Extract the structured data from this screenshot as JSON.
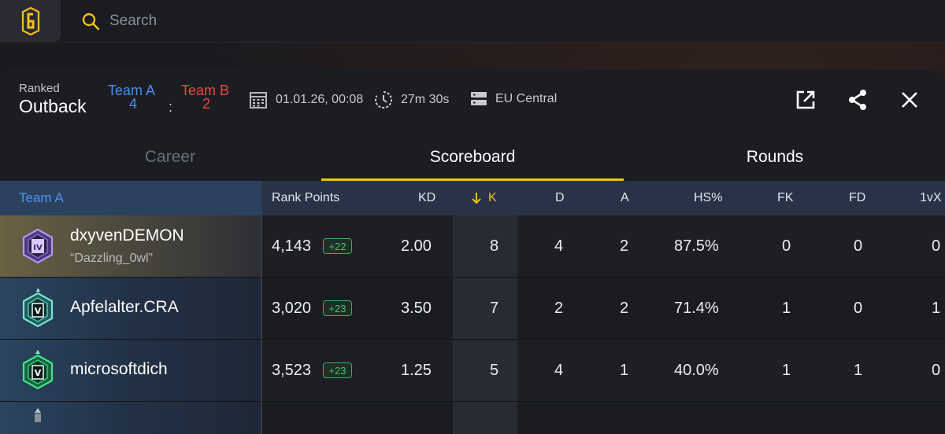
{
  "search": {
    "placeholder": "Search"
  },
  "match": {
    "mode": "Ranked",
    "map": "Outback",
    "team_a": {
      "name": "Team A",
      "score": "4"
    },
    "team_b": {
      "name": "Team B",
      "score": "2"
    },
    "score_separator": ":",
    "datetime": "01.01.26, 00:08",
    "duration": "27m 30s",
    "server": "EU Central"
  },
  "tabs": [
    {
      "label": "Career",
      "active": false
    },
    {
      "label": "Scoreboard",
      "active": true
    },
    {
      "label": "Rounds",
      "active": false
    }
  ],
  "table": {
    "team_header": "Team A",
    "columns": {
      "rank_points": "Rank Points",
      "kd": "KD",
      "k": "K",
      "d": "D",
      "a": "A",
      "hs": "HS%",
      "fk": "FK",
      "fd": "FD",
      "onevx": "1vX"
    },
    "sort_column": "K",
    "rows": [
      {
        "name": "dxyvenDEMON",
        "alias": "“Dazzling_0wl”",
        "rank_badge": "IV",
        "rank_points": "4,143",
        "rp_delta": "+22",
        "kd": "2.00",
        "k": "8",
        "d": "4",
        "a": "2",
        "hs": "87.5%",
        "fk": "0",
        "fd": "0",
        "onevx": "0"
      },
      {
        "name": "Apfelalter.CRA",
        "alias": "",
        "rank_badge": "V",
        "rank_points": "3,020",
        "rp_delta": "+23",
        "kd": "3.50",
        "k": "7",
        "d": "2",
        "a": "2",
        "hs": "71.4%",
        "fk": "1",
        "fd": "0",
        "onevx": "1"
      },
      {
        "name": "microsoftdich",
        "alias": "",
        "rank_badge": "V",
        "rank_points": "3,523",
        "rp_delta": "+23",
        "kd": "1.25",
        "k": "5",
        "d": "4",
        "a": "1",
        "hs": "40.0%",
        "fk": "1",
        "fd": "1",
        "onevx": "0"
      }
    ]
  },
  "colors": {
    "accent": "#f2c01e",
    "team_a": "#4a8ff0",
    "team_b": "#ea4b3a",
    "positive_delta": "#47c266",
    "badge_diamond": "#9a6be0",
    "badge_emerald": "#2fcf86"
  },
  "icons": {
    "logo": "rainbow-six-logo-icon",
    "search": "search-icon",
    "date": "calendar-icon",
    "duration": "clock-icon",
    "server": "server-icon",
    "open_external": "open-external-icon",
    "share": "share-icon",
    "close": "close-icon",
    "sort": "sort-down-arrow-icon"
  }
}
